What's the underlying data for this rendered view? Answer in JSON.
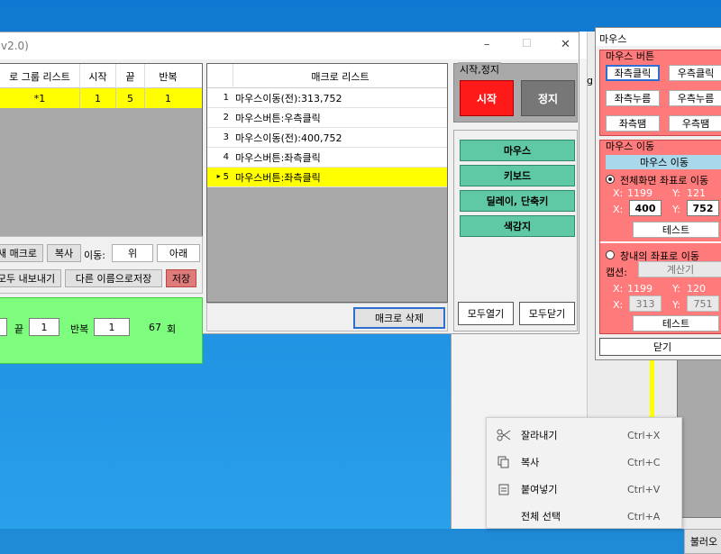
{
  "main": {
    "title_fragment": "v2.0)",
    "group_headers": [
      "로 그룹 리스트",
      "시작",
      "끝",
      "반복"
    ],
    "group_row": {
      "name": "*1",
      "start": "1",
      "end": "5",
      "repeat": "1"
    },
    "macro_header": "매크로 리스트",
    "macro_rows": [
      {
        "num": "1",
        "text": "마우스이동(전):313,752"
      },
      {
        "num": "2",
        "text": "마우스버튼:우측클릭"
      },
      {
        "num": "3",
        "text": "마우스이동(전):400,752"
      },
      {
        "num": "4",
        "text": "마우스버튼:좌측클릭"
      },
      {
        "num": "5",
        "text": "마우스버튼:좌측클릭"
      }
    ],
    "row_arrow": "▸",
    "btn_macro": "새 매크로",
    "btn_copy": "복사",
    "move_label": "이동:",
    "btn_up": "위",
    "btn_down": "아래",
    "btn_export": "모두 내보내기",
    "btn_saveas": "다른 이름으로저장",
    "btn_save": "저장",
    "end_label": "끝",
    "end_value": "1",
    "repeat_label": "반복",
    "repeat_value": "1",
    "count_value": "67",
    "count_unit": "회",
    "start_value_partial": "",
    "btn_delete": "매크로 삭제",
    "startstop_label": "시작,정지",
    "btn_start": "시작",
    "btn_stop": "정지",
    "categories": [
      "마우스",
      "키보드",
      "딜레이, 단축키",
      "색감지"
    ],
    "btn_expand_all": "모두열기",
    "btn_collapse_all": "모두닫기"
  },
  "mouse": {
    "title": "마우스",
    "button_group_label": "마우스 버튼",
    "btn_left_click": "좌측클릭",
    "btn_right_click": "우측클릭",
    "btn_left_press": "좌측누름",
    "btn_right_press": "우측누름",
    "btn_left_release": "좌측땜",
    "btn_right_release": "우측땜",
    "move_group_label": "마우스 이동",
    "move_header": "마우스 이동",
    "radio_full": "전체화면 좌표로 이동",
    "full_x_label": "X:",
    "full_x_cur": "1199",
    "full_y_label": "Y:",
    "full_y_cur": "121",
    "full_x_input": "400",
    "full_y_input": "752",
    "btn_test1": "테스트",
    "radio_window": "창내의 좌표로 이동",
    "caption_label": "캡션:",
    "caption_value": "계산기",
    "win_x_cur": "1199",
    "win_y_cur": "120",
    "win_x_input": "313",
    "win_y_input": "751",
    "btn_test2": "테스트",
    "btn_close": "닫기"
  },
  "bg": {
    "text_g": "g",
    "text_load": "불러오"
  },
  "context_menu": [
    {
      "icon": "scissors-icon",
      "label": "잘라내기",
      "shortcut": "Ctrl+X"
    },
    {
      "icon": "copy-icon",
      "label": "복사",
      "shortcut": "Ctrl+C"
    },
    {
      "icon": "paste-icon",
      "label": "붙여넣기",
      "shortcut": "Ctrl+V"
    },
    {
      "icon": "",
      "label": "전체 선택",
      "shortcut": "Ctrl+A"
    }
  ],
  "titlebar_glyphs": {
    "minimize": "–",
    "maximize": "☐",
    "close": "✕"
  }
}
